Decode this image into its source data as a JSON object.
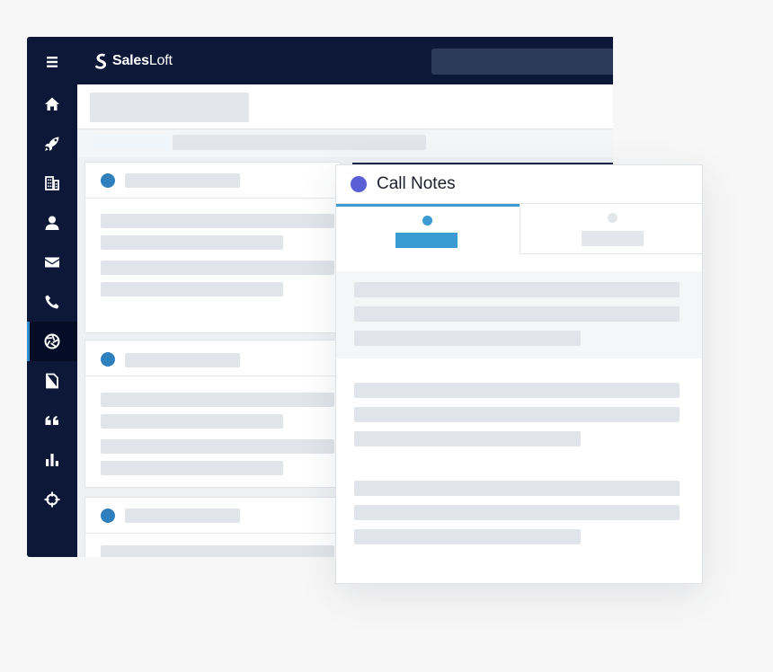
{
  "app": {
    "brand": {
      "name_bold": "Sales",
      "name_regular": "Loft"
    }
  },
  "sidebar": {
    "items": [
      {
        "icon": "menu-icon",
        "active": false
      },
      {
        "icon": "home-icon",
        "active": false
      },
      {
        "icon": "rocket-icon",
        "active": false
      },
      {
        "icon": "building-icon",
        "active": false
      },
      {
        "icon": "person-icon",
        "active": false
      },
      {
        "icon": "mail-icon",
        "active": false
      },
      {
        "icon": "phone-icon",
        "active": false
      },
      {
        "icon": "aperture-icon",
        "active": true
      },
      {
        "icon": "document-icon",
        "active": false
      },
      {
        "icon": "quote-icon",
        "active": false
      },
      {
        "icon": "bar-chart-icon",
        "active": false
      },
      {
        "icon": "crosshair-icon",
        "active": false
      }
    ]
  },
  "panel": {
    "title": "Call Notes",
    "tabs": [
      {
        "active": true
      },
      {
        "active": false
      }
    ]
  },
  "colors": {
    "navy": "#0d1838",
    "accent_blue": "#3b9bd3",
    "dot_blue": "#2f7fbd",
    "purple": "#5a5fd6",
    "placeholder": "#e1e5ea"
  }
}
